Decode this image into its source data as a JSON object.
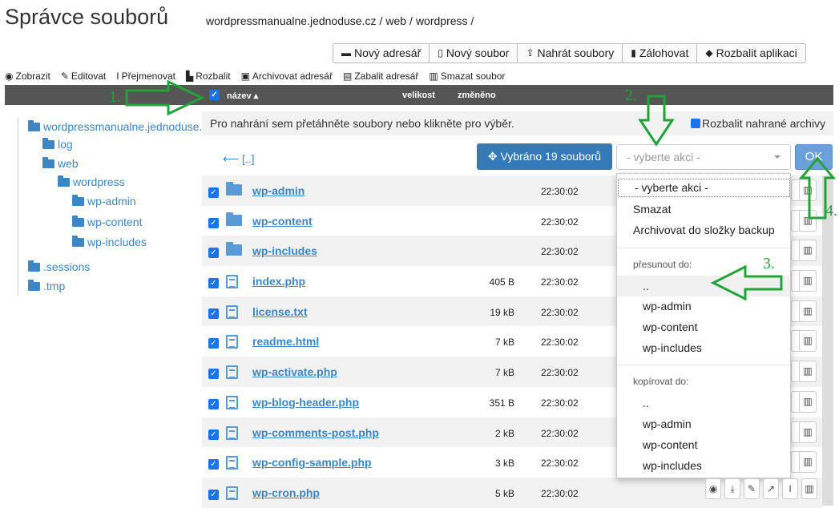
{
  "app_title": "Správce souborů",
  "breadcrumb": [
    "wordpressmanualne.jednoduse.cz",
    "/",
    "web",
    "/",
    "wordpress",
    "/"
  ],
  "toolbar": {
    "new_dir": "Nový adresář",
    "new_file": "Nový soubor",
    "upload": "Nahrát soubory",
    "backup": "Zálohovat",
    "unpack_app": "Rozbalit aplikaci"
  },
  "actions": [
    "Zobrazit",
    "Editovat",
    "Přejmenovat",
    "Rozbalit",
    "Archivovat adresář",
    "Zabalit adresář",
    "Smazat soubor"
  ],
  "table_header": {
    "name": "název",
    "size": "velikost",
    "modified": "změněno"
  },
  "tree": [
    {
      "label": "wordpressmanualne.jednoduse.c"
    },
    {
      "label": "log"
    },
    {
      "label": "web"
    },
    {
      "label": "wordpress"
    },
    {
      "label": "wp-admin"
    },
    {
      "label": "wp-content"
    },
    {
      "label": "wp-includes"
    },
    {
      "label": ".sessions"
    },
    {
      "label": ".tmp"
    }
  ],
  "upload_hint": "Pro nahrání sem přetáhněte soubory nebo klikněte pro výběr.",
  "unpack_archives": "Rozbalit nahrané archivy",
  "back_label": "[..]",
  "selected_button": "Vybráno 19 souborů",
  "action_select_placeholder": "- vyberte akci -",
  "ok_label": "OK",
  "files": [
    {
      "name": "wp-admin",
      "size": "",
      "time": "22:30:02",
      "type": "folder"
    },
    {
      "name": "wp-content",
      "size": "",
      "time": "22:30:02",
      "type": "folder"
    },
    {
      "name": "wp-includes",
      "size": "",
      "time": "22:30:02",
      "type": "folder"
    },
    {
      "name": "index.php",
      "size": "405 B",
      "time": "22:30:02",
      "type": "file"
    },
    {
      "name": "license.txt",
      "size": "19 kB",
      "time": "22:30:02",
      "type": "file"
    },
    {
      "name": "readme.html",
      "size": "7 kB",
      "time": "22:30:02",
      "type": "file"
    },
    {
      "name": "wp-activate.php",
      "size": "7 kB",
      "time": "22:30:02",
      "type": "file"
    },
    {
      "name": "wp-blog-header.php",
      "size": "351 B",
      "time": "22:30:02",
      "type": "file"
    },
    {
      "name": "wp-comments-post.php",
      "size": "2 kB",
      "time": "22:30:02",
      "type": "file"
    },
    {
      "name": "wp-config-sample.php",
      "size": "3 kB",
      "time": "22:30:02",
      "type": "file"
    },
    {
      "name": "wp-cron.php",
      "size": "5 kB",
      "time": "22:30:02",
      "type": "file"
    }
  ],
  "menu": {
    "placeholder": "- vyberte akci -",
    "delete": "Smazat",
    "archive": "Archivovat do složky backup",
    "move_header": "přesunout do:",
    "move_items": [
      "..",
      "wp-admin",
      "wp-content",
      "wp-includes"
    ],
    "copy_header": "kopírovat do:",
    "copy_items": [
      "..",
      "wp-admin",
      "wp-content",
      "wp-includes"
    ]
  },
  "annotations": [
    "1.",
    "2.",
    "3.",
    "4."
  ],
  "colors": {
    "accent": "#337ab7",
    "link": "#3b86c6",
    "annotation": "#22a33a",
    "header_bg": "#555555"
  }
}
